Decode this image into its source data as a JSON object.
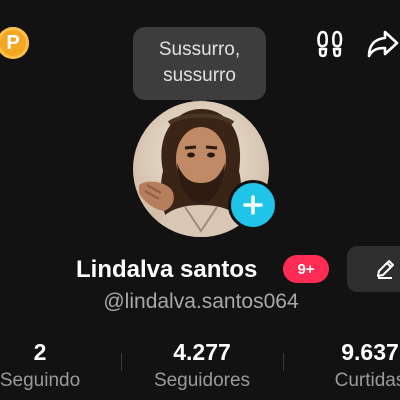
{
  "top_bar": {
    "coin_label": "P",
    "tooltip_text": "Sussurro, sussurro"
  },
  "profile": {
    "name": "Lindalva santos",
    "notification_badge": "9+",
    "handle": "@lindalva.santos064"
  },
  "stats": [
    {
      "value": "2",
      "label": "Seguindo"
    },
    {
      "value": "4.277",
      "label": "Seguidores"
    },
    {
      "value": "9.637",
      "label": "Curtidas"
    }
  ],
  "icons": {
    "coin": "coin-icon",
    "footprints": "footprints-icon",
    "share": "share-icon",
    "add": "plus-icon",
    "edit": "pencil-icon"
  },
  "colors": {
    "background": "#121212",
    "badge": "#fe2c55",
    "add_button": "#20c4e8",
    "coin": "#f5a623"
  }
}
